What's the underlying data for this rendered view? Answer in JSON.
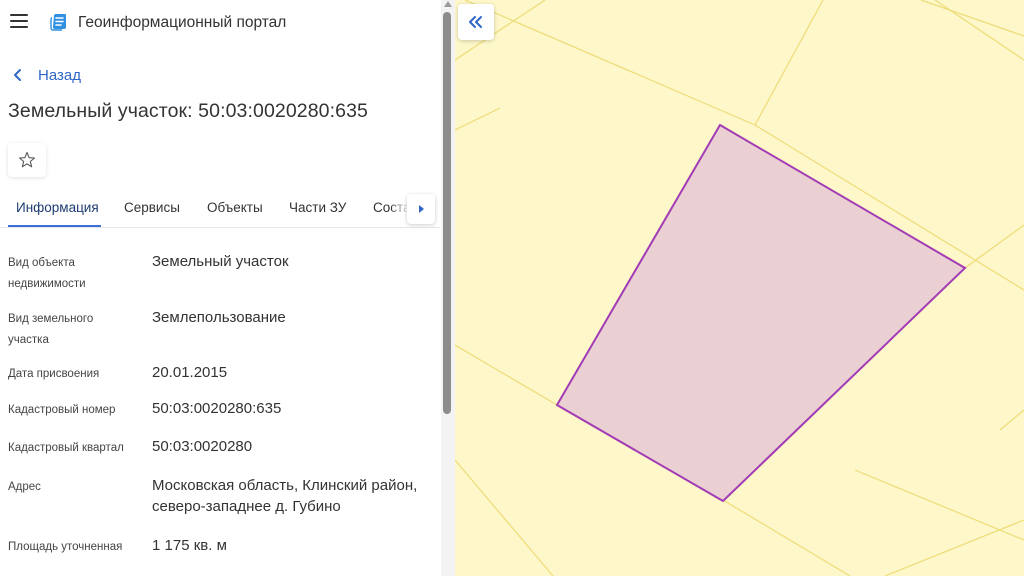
{
  "header": {
    "menu_icon": "hamburger-menu-icon",
    "logo_icon": "portal-logo-icon",
    "title": "Геоинформационный портал"
  },
  "navigation": {
    "back_label": "Назад",
    "back_icon": "chevron-left-icon"
  },
  "object": {
    "title": "Земельный участок: 50:03:0020280:635",
    "favorite_icon": "star-outline-icon"
  },
  "tabs": [
    {
      "label": "Информация",
      "active": true
    },
    {
      "label": "Сервисы",
      "active": false
    },
    {
      "label": "Объекты",
      "active": false
    },
    {
      "label": "Части ЗУ",
      "active": false
    },
    {
      "label": "Соста",
      "active": false
    }
  ],
  "tabs_scroll_icon": "caret-right-icon",
  "info": [
    {
      "label": "Вид объекта недвижимости",
      "value": "Земельный участок"
    },
    {
      "label": "Вид земельного участка",
      "value": "Землепользование"
    },
    {
      "label": "Дата присвоения",
      "value": "20.01.2015"
    },
    {
      "label": "Кадастровый номер",
      "value": "50:03:0020280:635"
    },
    {
      "label": "Кадастровый квартал",
      "value": "50:03:0020280"
    },
    {
      "label": "Адрес",
      "value": "Московская область, Клинский район, северо-западнее д. Губино"
    },
    {
      "label": "Площадь уточненная",
      "value": "1 175 кв. м"
    }
  ],
  "map": {
    "collapse_icon": "double-chevron-left-icon",
    "background_color": "#fdf7c9",
    "grid_line_color": "#eedc78",
    "parcel_fill": "#ead0d2",
    "parcel_stroke": "#a23bb5"
  },
  "colors": {
    "accent": "#2f66c7",
    "tab_underline": "#3a6fd8"
  }
}
